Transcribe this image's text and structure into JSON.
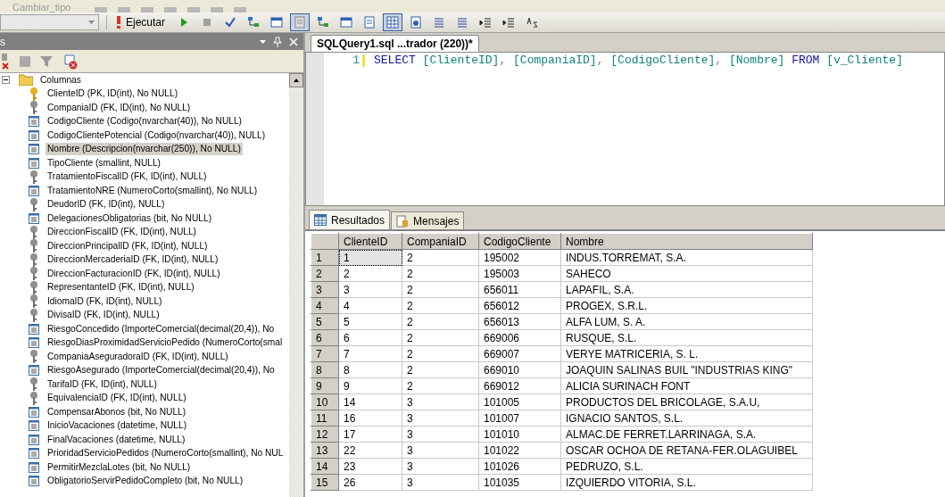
{
  "top_toolbar": {
    "dropdown": "Cambiar_tipo"
  },
  "query_toolbar": {
    "execute_label": "Ejecutar",
    "buttons": [
      {
        "kind": "play",
        "pressed": false
      },
      {
        "kind": "stop",
        "pressed": false
      },
      {
        "kind": "parse",
        "pressed": false
      },
      {
        "kind": "plan",
        "pressed": false
      },
      {
        "kind": "window",
        "pressed": false
      },
      {
        "kind": "panel",
        "pressed": true
      },
      {
        "kind": "plan",
        "pressed": false
      },
      {
        "kind": "window",
        "pressed": false
      },
      {
        "kind": "text",
        "pressed": false
      },
      {
        "kind": "grid",
        "pressed": true
      },
      {
        "kind": "file",
        "pressed": false
      },
      {
        "kind": "lines",
        "pressed": false
      },
      {
        "kind": "lines",
        "pressed": false
      },
      {
        "kind": "indent",
        "pressed": false
      },
      {
        "kind": "indent",
        "pressed": false
      },
      {
        "kind": "abc",
        "pressed": false
      }
    ]
  },
  "explorer": {
    "title": "s",
    "tree": {
      "label": "Columnas",
      "expanded": true,
      "children": [
        {
          "label": "ClienteID (PK, ID(int), No NULL)",
          "kind": "pk",
          "selected": false
        },
        {
          "label": "CompaniaID (FK, ID(int), No NULL)",
          "kind": "fk",
          "selected": false
        },
        {
          "label": "CodigoCliente (Codigo(nvarchar(40)), No NULL)",
          "kind": "column",
          "selected": false
        },
        {
          "label": "CodigoClientePotencial (Codigo(nvarchar(40)), NULL)",
          "kind": "column",
          "selected": false
        },
        {
          "label": "Nombre (Descripcion(nvarchar(250)), No NULL)",
          "kind": "column",
          "selected": true
        },
        {
          "label": "TipoCliente (smallint, NULL)",
          "kind": "column",
          "selected": false
        },
        {
          "label": "TratamientoFiscalID (FK, ID(int), NULL)",
          "kind": "fk",
          "selected": false
        },
        {
          "label": "TratamientoNRE (NumeroCorto(smallint), No NULL)",
          "kind": "column",
          "selected": false
        },
        {
          "label": "DeudorID (FK, ID(int), NULL)",
          "kind": "fk",
          "selected": false
        },
        {
          "label": "DelegacionesObligatorias (bit, No NULL)",
          "kind": "column",
          "selected": false
        },
        {
          "label": "DireccionFiscalID (FK, ID(int), NULL)",
          "kind": "fk",
          "selected": false
        },
        {
          "label": "DireccionPrincipalID (FK, ID(int), NULL)",
          "kind": "fk",
          "selected": false
        },
        {
          "label": "DireccionMercaderiaID (FK, ID(int), NULL)",
          "kind": "fk",
          "selected": false
        },
        {
          "label": "DireccionFacturacionID (FK, ID(int), NULL)",
          "kind": "fk",
          "selected": false
        },
        {
          "label": "RepresentanteID (FK, ID(int), NULL)",
          "kind": "fk",
          "selected": false
        },
        {
          "label": "IdiomaID (FK, ID(int), NULL)",
          "kind": "fk",
          "selected": false
        },
        {
          "label": "DivisaID (FK, ID(int), NULL)",
          "kind": "fk",
          "selected": false
        },
        {
          "label": "RiesgoConcedido (ImporteComercial(decimal(20,4)), No",
          "kind": "column",
          "selected": false
        },
        {
          "label": "RiesgoDiasProximidadServicioPedido (NumeroCorto(smal",
          "kind": "column",
          "selected": false
        },
        {
          "label": "CompaniaAseguradoraID (FK, ID(int), NULL)",
          "kind": "fk",
          "selected": false
        },
        {
          "label": "RiesgoAsegurado (ImporteComercial(decimal(20,4)), No",
          "kind": "column",
          "selected": false
        },
        {
          "label": "TarifaID (FK, ID(int), NULL)",
          "kind": "fk",
          "selected": false
        },
        {
          "label": "EquivalenciaID (FK, ID(int), NULL)",
          "kind": "fk",
          "selected": false
        },
        {
          "label": "CompensarAbonos (bit, No NULL)",
          "kind": "column",
          "selected": false
        },
        {
          "label": "InicioVacaciones (datetime, NULL)",
          "kind": "column",
          "selected": false
        },
        {
          "label": "FinalVacaciones (datetime, NULL)",
          "kind": "column",
          "selected": false
        },
        {
          "label": "PrioridadServicioPedidos (NumeroCorto(smallint), No NUL",
          "kind": "column",
          "selected": false
        },
        {
          "label": "PermitirMezclaLotes (bit, No NULL)",
          "kind": "column",
          "selected": false
        },
        {
          "label": "ObligatorioServirPedidoCompleto (bit, No NULL)",
          "kind": "column",
          "selected": false
        }
      ]
    }
  },
  "editor": {
    "tab": "SQLQuery1.sql ...trador (220))*",
    "line_number": "1",
    "tokens": [
      {
        "text": "SELECT",
        "kind": "keyword"
      },
      {
        "text": "[ClienteID]",
        "kind": "identifier"
      },
      {
        "text": ", ",
        "kind": "punct"
      },
      {
        "text": "[CompaniaID]",
        "kind": "identifier"
      },
      {
        "text": ", ",
        "kind": "punct"
      },
      {
        "text": "[CodigoCliente]",
        "kind": "identifier"
      },
      {
        "text": ", ",
        "kind": "punct"
      },
      {
        "text": "[Nombre]",
        "kind": "identifier"
      },
      {
        "text": "FROM",
        "kind": "keyword"
      },
      {
        "text": "[v_Cliente]",
        "kind": "identifier"
      }
    ]
  },
  "result_tabs": [
    {
      "label": "Resultados",
      "kind": "grid",
      "selected": true
    },
    {
      "label": "Mensajes",
      "kind": "messages",
      "selected": false
    }
  ],
  "grid": {
    "columns": [
      "ClienteID",
      "CompaniaID",
      "CodigoCliente",
      "Nombre"
    ],
    "rows": [
      {
        "number": "1",
        "cells": [
          "1",
          "2",
          "195002",
          "INDUS.TORREMAT, S.A."
        ],
        "focused": true
      },
      {
        "number": "2",
        "cells": [
          "2",
          "2",
          "195003",
          "SAHECO"
        ]
      },
      {
        "number": "3",
        "cells": [
          "3",
          "2",
          "656011",
          "LAPAFIL, S.A."
        ]
      },
      {
        "number": "4",
        "cells": [
          "4",
          "2",
          "656012",
          "PROGEX, S.R.L."
        ]
      },
      {
        "number": "5",
        "cells": [
          "5",
          "2",
          "656013",
          "ALFA LUM, S. A."
        ]
      },
      {
        "number": "6",
        "cells": [
          "6",
          "2",
          "669006",
          "RUSQUE, S.L."
        ]
      },
      {
        "number": "7",
        "cells": [
          "7",
          "2",
          "669007",
          "VERYE MATRICERIA, S. L."
        ]
      },
      {
        "number": "8",
        "cells": [
          "8",
          "2",
          "669010",
          "JOAQUIN SALINAS BUIL \"INDUSTRIAS KING\""
        ]
      },
      {
        "number": "9",
        "cells": [
          "9",
          "2",
          "669012",
          "ALICIA SURINACH FONT"
        ]
      },
      {
        "number": "10",
        "cells": [
          "14",
          "3",
          "101005",
          "PRODUCTOS DEL BRICOLAGE, S.A.U,"
        ]
      },
      {
        "number": "11",
        "cells": [
          "16",
          "3",
          "101007",
          "IGNACIO SANTOS, S.L."
        ]
      },
      {
        "number": "12",
        "cells": [
          "17",
          "3",
          "101010",
          "ALMAC.DE FERRET.LARRINAGA, S.A."
        ]
      },
      {
        "number": "13",
        "cells": [
          "22",
          "3",
          "101022",
          "OSCAR OCHOA DE RETANA-FER.OLAGUIBEL"
        ]
      },
      {
        "number": "14",
        "cells": [
          "23",
          "3",
          "101026",
          "PEDRUZO, S.L."
        ]
      },
      {
        "number": "15",
        "cells": [
          "26",
          "3",
          "101035",
          "IZQUIERDO VITORIA, S.L."
        ]
      }
    ]
  }
}
